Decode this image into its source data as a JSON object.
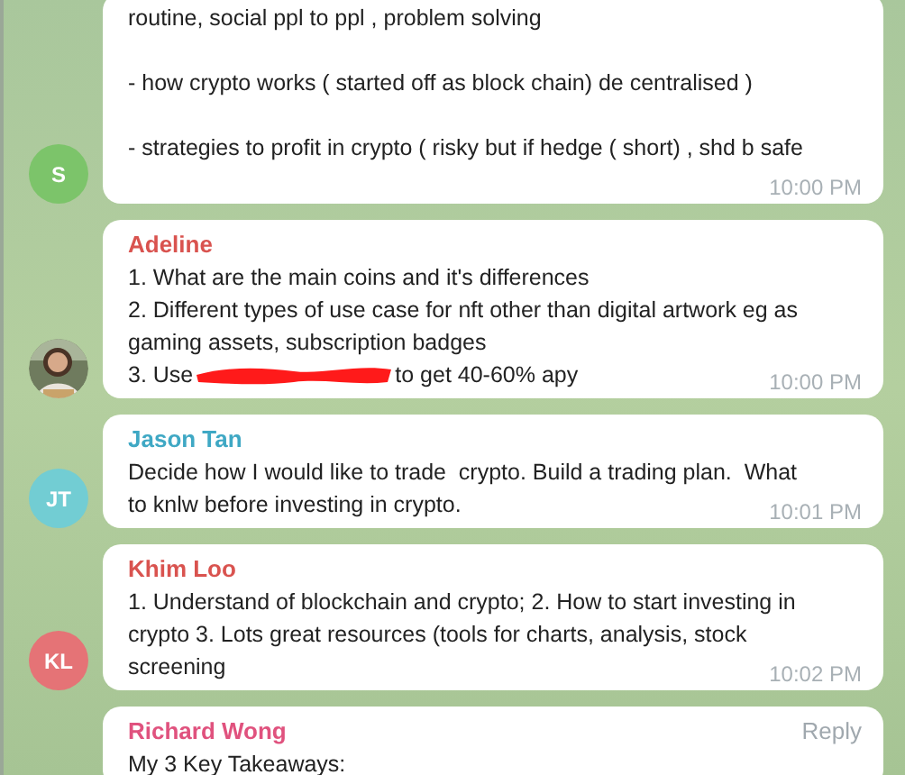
{
  "messages": [
    {
      "avatar": {
        "kind": "initials",
        "initials": "S",
        "color": "#7cc46a"
      },
      "blank_line_between": true,
      "lines": [
        "routine, social ppl to ppl , problem solving",
        "- how crypto works ( started off as block chain) de centralised )",
        "- strategies to profit in crypto ( risky but if hedge ( short) , shd b safe"
      ],
      "time": "10:00 PM"
    },
    {
      "sender": {
        "name": "Adeline",
        "color": "#d9534f"
      },
      "avatar": {
        "kind": "picture"
      },
      "lines": [
        "1. What are the main coins and it's differences",
        "2. Different types of use case for nft other than digital artwork eg as",
        "gaming assets, subscription badges",
        {
          "before": "3. Use",
          "after": "to get 40-60% apy",
          "redacted": true
        }
      ],
      "time": "10:00 PM"
    },
    {
      "sender": {
        "name": "Jason Tan",
        "color": "#3fa8c4"
      },
      "avatar": {
        "kind": "initials",
        "initials": "JT",
        "color": "#72cdd3"
      },
      "lines": [
        "Decide how I would like to trade  crypto. Build a trading plan.  What",
        "to knlw before investing in crypto."
      ],
      "time": "10:01 PM"
    },
    {
      "sender": {
        "name": "Khim Loo",
        "color": "#d9534f"
      },
      "avatar": {
        "kind": "initials",
        "initials": "KL",
        "color": "#e57376"
      },
      "lines": [
        "1. Understand of blockchain and crypto; 2. How to start investing in",
        "crypto 3. Lots great resources (tools for charts, analysis, stock",
        "screening"
      ],
      "time": "10:02 PM"
    },
    {
      "sender": {
        "name": "Richard Wong",
        "color": "#e0527e"
      },
      "reply": "Reply",
      "lines": [
        "My 3 Key Takeaways:"
      ]
    }
  ]
}
